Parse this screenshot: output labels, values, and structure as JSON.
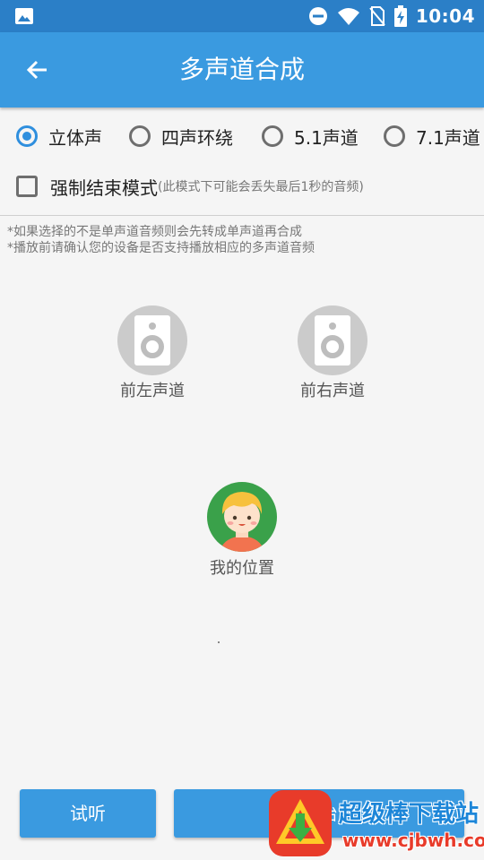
{
  "status_bar": {
    "time": "10:04",
    "icons": [
      "image-icon",
      "dnd-icon",
      "wifi-icon",
      "no-sim-icon",
      "battery-charging-icon"
    ]
  },
  "app_bar": {
    "title": "多声道合成",
    "back_icon": "arrow-left-icon"
  },
  "channel_options": [
    {
      "label": "立体声",
      "checked": true
    },
    {
      "label": "四声环绕",
      "checked": false
    },
    {
      "label": "5.1声道",
      "checked": false
    },
    {
      "label": "7.1声道",
      "checked": false
    }
  ],
  "force_end": {
    "label": "强制结束模式",
    "note": "(此模式下可能会丢失最后1秒的音频)",
    "checked": false
  },
  "notes": [
    "*如果选择的不是单声道音频则会先转成单声道再合成",
    "*播放前请确认您的设备是否支持播放相应的多声道音频"
  ],
  "speakers": [
    {
      "label": "前左声道"
    },
    {
      "label": "前右声道"
    }
  ],
  "listener": {
    "label": "我的位置"
  },
  "buttons": {
    "preview": "试听",
    "start": "开始"
  },
  "watermark": {
    "text": "超级棒下载站",
    "url": "www.cjbwh.com"
  },
  "colors": {
    "status_bar": "#2b7fc7",
    "app_bar": "#3a9ae0",
    "accent": "#2f8fde",
    "avatar_bg": "#3aa14a",
    "watermark_red": "#e83b2a"
  }
}
